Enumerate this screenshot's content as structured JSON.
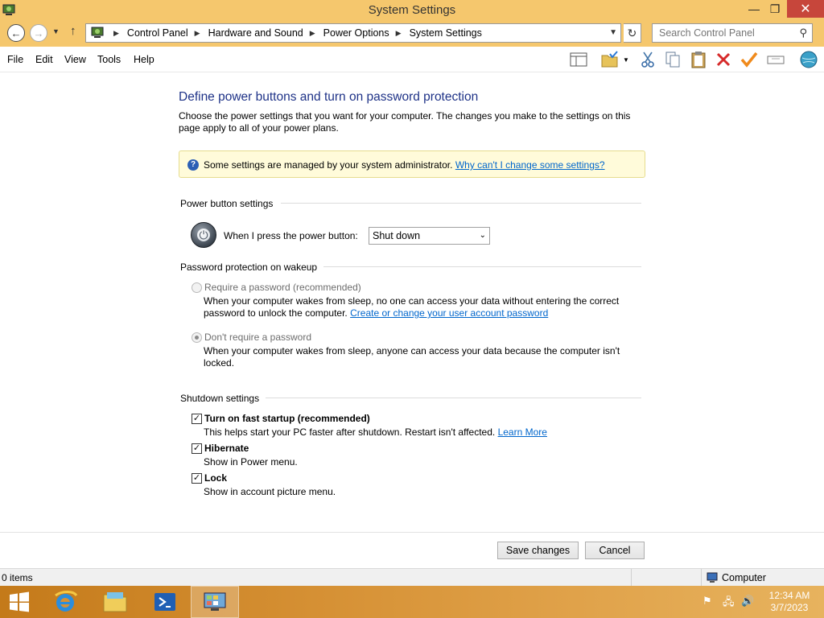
{
  "window": {
    "title": "System Settings",
    "minimize": "—",
    "maximize": "❐",
    "close": "✕"
  },
  "address": {
    "crumbs": [
      "Control Panel",
      "Hardware and Sound",
      "Power Options",
      "System Settings"
    ],
    "search_placeholder": "Search Control Panel"
  },
  "menu": [
    "File",
    "Edit",
    "View",
    "Tools",
    "Help"
  ],
  "page": {
    "heading": "Define power buttons and turn on password protection",
    "description": "Choose the power settings that you want for your computer. The changes you make to the settings on this page apply to all of your power plans.",
    "info_text": "Some settings are managed by your system administrator.",
    "info_link": "Why can't I change some settings?",
    "power_section": "Power button settings",
    "power_label": "When I press the power button:",
    "power_value": "Shut down",
    "password_section": "Password protection on wakeup",
    "require_label": "Require a password (recommended)",
    "require_desc": "When your computer wakes from sleep, no one can access your data without entering the correct",
    "require_desc2": "password to unlock the computer.",
    "require_link": "Create or change your user account password",
    "norequire_label": "Don't require a password",
    "norequire_desc": "When your computer wakes from sleep, anyone can access your data because the computer isn't locked.",
    "shutdown_section": "Shutdown settings",
    "fast_label": "Turn on fast startup (recommended)",
    "fast_desc": "This helps start your PC faster after shutdown. Restart isn't affected.",
    "fast_link": "Learn More",
    "hibernate_label": "Hibernate",
    "hibernate_desc": "Show in Power menu.",
    "lock_label": "Lock",
    "lock_desc": "Show in account picture menu.",
    "save": "Save changes",
    "cancel": "Cancel"
  },
  "status": {
    "items": "0 items",
    "location": "Computer"
  },
  "taskbar": {
    "time": "12:34 AM",
    "date": "3/7/2023"
  }
}
